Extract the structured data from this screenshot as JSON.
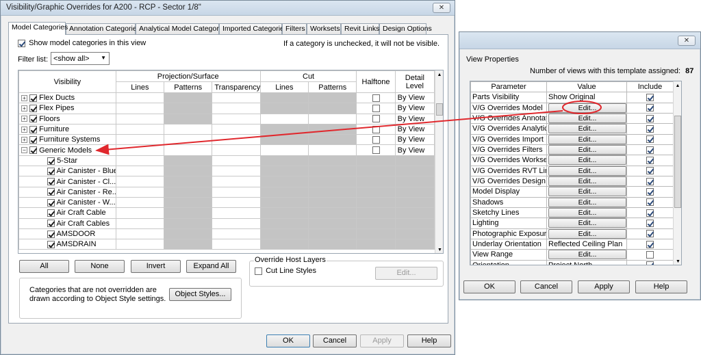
{
  "vg_dialog": {
    "title": "Visibility/Graphic Overrides for A200 - RCP - Sector 1/8\"",
    "tabs": [
      "Model Categories",
      "Annotation Categories",
      "Analytical Model Categories",
      "Imported Categories",
      "Filters",
      "Worksets",
      "Revit Links",
      "Design Options"
    ],
    "show_categories_label": "Show model categories in this view",
    "hint": "If a category is unchecked, it will not be visible.",
    "filter_label": "Filter list:",
    "filter_value": "<show all>",
    "headers": {
      "visibility": "Visibility",
      "projection": "Projection/Surface",
      "cut": "Cut",
      "halftone": "Halftone",
      "detail_level": "Detail Level",
      "lines": "Lines",
      "patterns": "Patterns",
      "transparency": "Transparency",
      "cut_lines": "Lines",
      "cut_patterns": "Patterns"
    },
    "rows": [
      {
        "name": "Flex Ducts",
        "detail": "By View"
      },
      {
        "name": "Flex Pipes",
        "detail": "By View"
      },
      {
        "name": "Floors",
        "detail": "By View"
      },
      {
        "name": "Furniture",
        "detail": "By View"
      },
      {
        "name": "Furniture Systems",
        "detail": "By View"
      },
      {
        "name": "Generic Models",
        "detail": "By View"
      },
      {
        "name": "5-Star",
        "detail": ""
      },
      {
        "name": "Air Canister - Blue",
        "detail": ""
      },
      {
        "name": "Air Canister - Cl...",
        "detail": ""
      },
      {
        "name": "Air Canister - Re...",
        "detail": ""
      },
      {
        "name": "Air Canister - W...",
        "detail": ""
      },
      {
        "name": "Air Craft Cable",
        "detail": ""
      },
      {
        "name": "Air Craft Cables",
        "detail": ""
      },
      {
        "name": "AMSDOOR",
        "detail": ""
      },
      {
        "name": "AMSDRAIN",
        "detail": ""
      }
    ],
    "buttons": {
      "all": "All",
      "none": "None",
      "invert": "Invert",
      "expand_all": "Expand All"
    },
    "override_host_layers": "Override Host Layers",
    "cut_line_styles": "Cut Line Styles",
    "edit": "Edit...",
    "note": "Categories that are not overridden are drawn according to Object Style settings.",
    "object_styles": "Object Styles...",
    "ok": "OK",
    "cancel": "Cancel",
    "apply": "Apply",
    "help": "Help"
  },
  "view_properties": {
    "title": "View Properties",
    "count_label": "Number of views with this template assigned:",
    "count": "87",
    "headers": {
      "parameter": "Parameter",
      "value": "Value",
      "include": "Include"
    },
    "rows": [
      {
        "param": "Parts Visibility",
        "value": "Show Original",
        "include": true
      },
      {
        "param": "V/G Overrides Model",
        "value": "Edit...",
        "include": true
      },
      {
        "param": "V/G Overrides Annotati",
        "value": "Edit...",
        "include": true
      },
      {
        "param": "V/G Overrides Analytica",
        "value": "Edit...",
        "include": true
      },
      {
        "param": "V/G Overrides Import",
        "value": "Edit...",
        "include": true
      },
      {
        "param": "V/G Overrides Filters",
        "value": "Edit...",
        "include": true
      },
      {
        "param": "V/G Overrides Worksets",
        "value": "Edit...",
        "include": true
      },
      {
        "param": "V/G Overrides RVT Links",
        "value": "Edit...",
        "include": true
      },
      {
        "param": "V/G Overrides Design O",
        "value": "Edit...",
        "include": true
      },
      {
        "param": "Model Display",
        "value": "Edit...",
        "include": true
      },
      {
        "param": "Shadows",
        "value": "Edit...",
        "include": true
      },
      {
        "param": "Sketchy Lines",
        "value": "Edit...",
        "include": true
      },
      {
        "param": "Lighting",
        "value": "Edit...",
        "include": true
      },
      {
        "param": "Photographic Exposure",
        "value": "Edit...",
        "include": true
      },
      {
        "param": "Underlay Orientation",
        "value": "Reflected Ceiling Plan",
        "include": true
      },
      {
        "param": "View Range",
        "value": "Edit...",
        "include": false
      },
      {
        "param": "Orientation",
        "value": "Project North",
        "include": true
      }
    ],
    "ok": "OK",
    "cancel": "Cancel",
    "apply": "Apply",
    "help": "Help"
  },
  "colors": {
    "annotation_red": "#e0282d",
    "disabled_cell": "#c4c4c4"
  }
}
